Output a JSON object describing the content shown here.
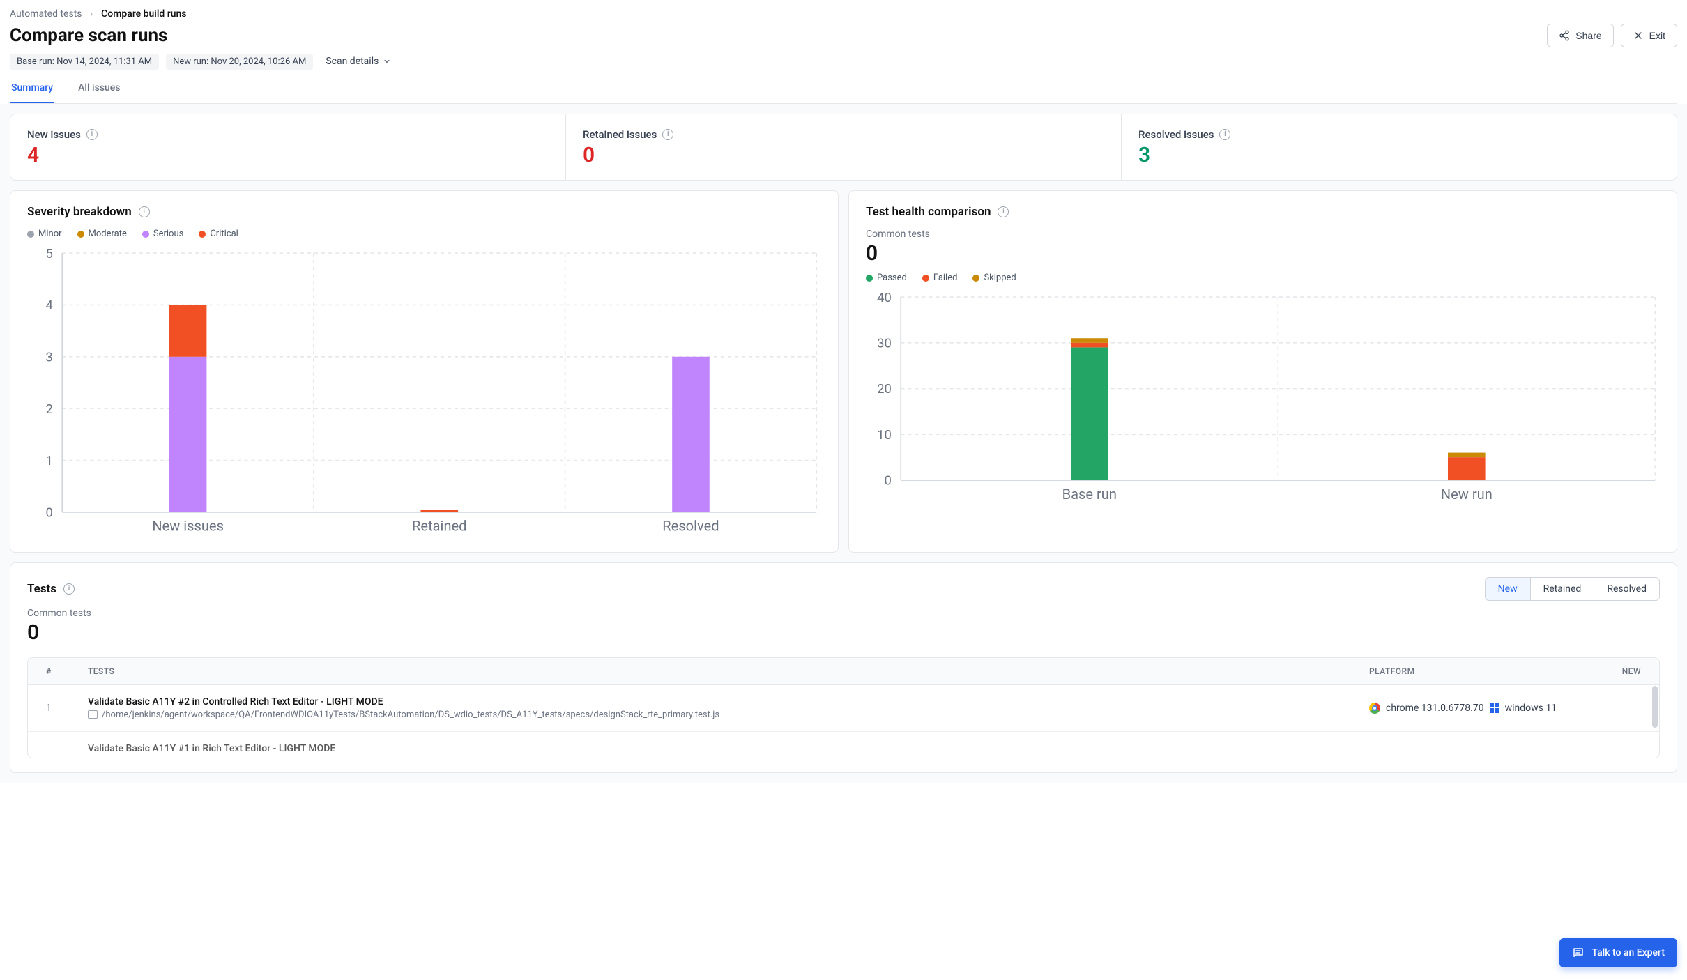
{
  "breadcrumb": {
    "root": "Automated tests",
    "current": "Compare build runs"
  },
  "page_title": "Compare scan runs",
  "actions": {
    "share": "Share",
    "exit": "Exit"
  },
  "meta": {
    "base_run": "Base run: Nov 14, 2024, 11:31 AM",
    "new_run": "New run: Nov 20, 2024, 10:26 AM",
    "scan_details": "Scan details"
  },
  "tabs": {
    "summary": "Summary",
    "all_issues": "All issues"
  },
  "stats": {
    "new_label": "New issues",
    "new_value": "4",
    "retained_label": "Retained issues",
    "retained_value": "0",
    "resolved_label": "Resolved issues",
    "resolved_value": "3"
  },
  "severity": {
    "title": "Severity breakdown",
    "legend": {
      "minor": "Minor",
      "moderate": "Moderate",
      "serious": "Serious",
      "critical": "Critical"
    },
    "colors": {
      "minor": "#9ca3af",
      "moderate": "#ca8a04",
      "serious": "#c084fc",
      "critical": "#f05023"
    }
  },
  "health": {
    "title": "Test health comparison",
    "common_label": "Common tests",
    "common_value": "0",
    "legend": {
      "passed": "Passed",
      "failed": "Failed",
      "skipped": "Skipped"
    },
    "colors": {
      "passed": "#22a565",
      "failed": "#f05023",
      "skipped": "#ca8a04"
    }
  },
  "tests_section": {
    "title": "Tests",
    "segments": {
      "new": "New",
      "retained": "Retained",
      "resolved": "Resolved"
    },
    "common_label": "Common tests",
    "common_value": "0",
    "columns": {
      "n": "#",
      "tests": "TESTS",
      "platform": "PLATFORM",
      "new": "NEW"
    },
    "rows": [
      {
        "n": "1",
        "name": "Validate Basic A11Y #2 in Controlled Rich Text Editor - LIGHT MODE",
        "path": "/home/jenkins/agent/workspace/QA/FrontendWDIOA11yTests/BStackAutomation/DS_wdio_tests/DS_A11Y_tests/specs/designStack_rte_primary.test.js",
        "browser": "chrome 131.0.6778.70",
        "os": "windows 11"
      },
      {
        "n": "",
        "name": "Validate Basic A11Y #1 in Rich Text Editor - LIGHT MODE",
        "path": "",
        "browser": "",
        "os": ""
      }
    ]
  },
  "expert_button": "Talk to an Expert",
  "chart_data": [
    {
      "type": "bar",
      "title": "Severity breakdown",
      "categories": [
        "New issues",
        "Retained",
        "Resolved"
      ],
      "series": [
        {
          "name": "Minor",
          "values": [
            0,
            0,
            0
          ]
        },
        {
          "name": "Moderate",
          "values": [
            0,
            0,
            0
          ]
        },
        {
          "name": "Serious",
          "values": [
            3,
            0,
            3
          ]
        },
        {
          "name": "Critical",
          "values": [
            1,
            0,
            0
          ]
        }
      ],
      "ylim": [
        0,
        5
      ],
      "yticks": [
        0,
        1,
        2,
        3,
        4,
        5
      ]
    },
    {
      "type": "bar",
      "title": "Test health comparison",
      "categories": [
        "Base run",
        "New run"
      ],
      "series": [
        {
          "name": "Passed",
          "values": [
            29,
            0
          ]
        },
        {
          "name": "Failed",
          "values": [
            1,
            5
          ]
        },
        {
          "name": "Skipped",
          "values": [
            1,
            1
          ]
        }
      ],
      "ylim": [
        0,
        40
      ],
      "yticks": [
        0,
        10,
        20,
        30,
        40
      ]
    }
  ]
}
